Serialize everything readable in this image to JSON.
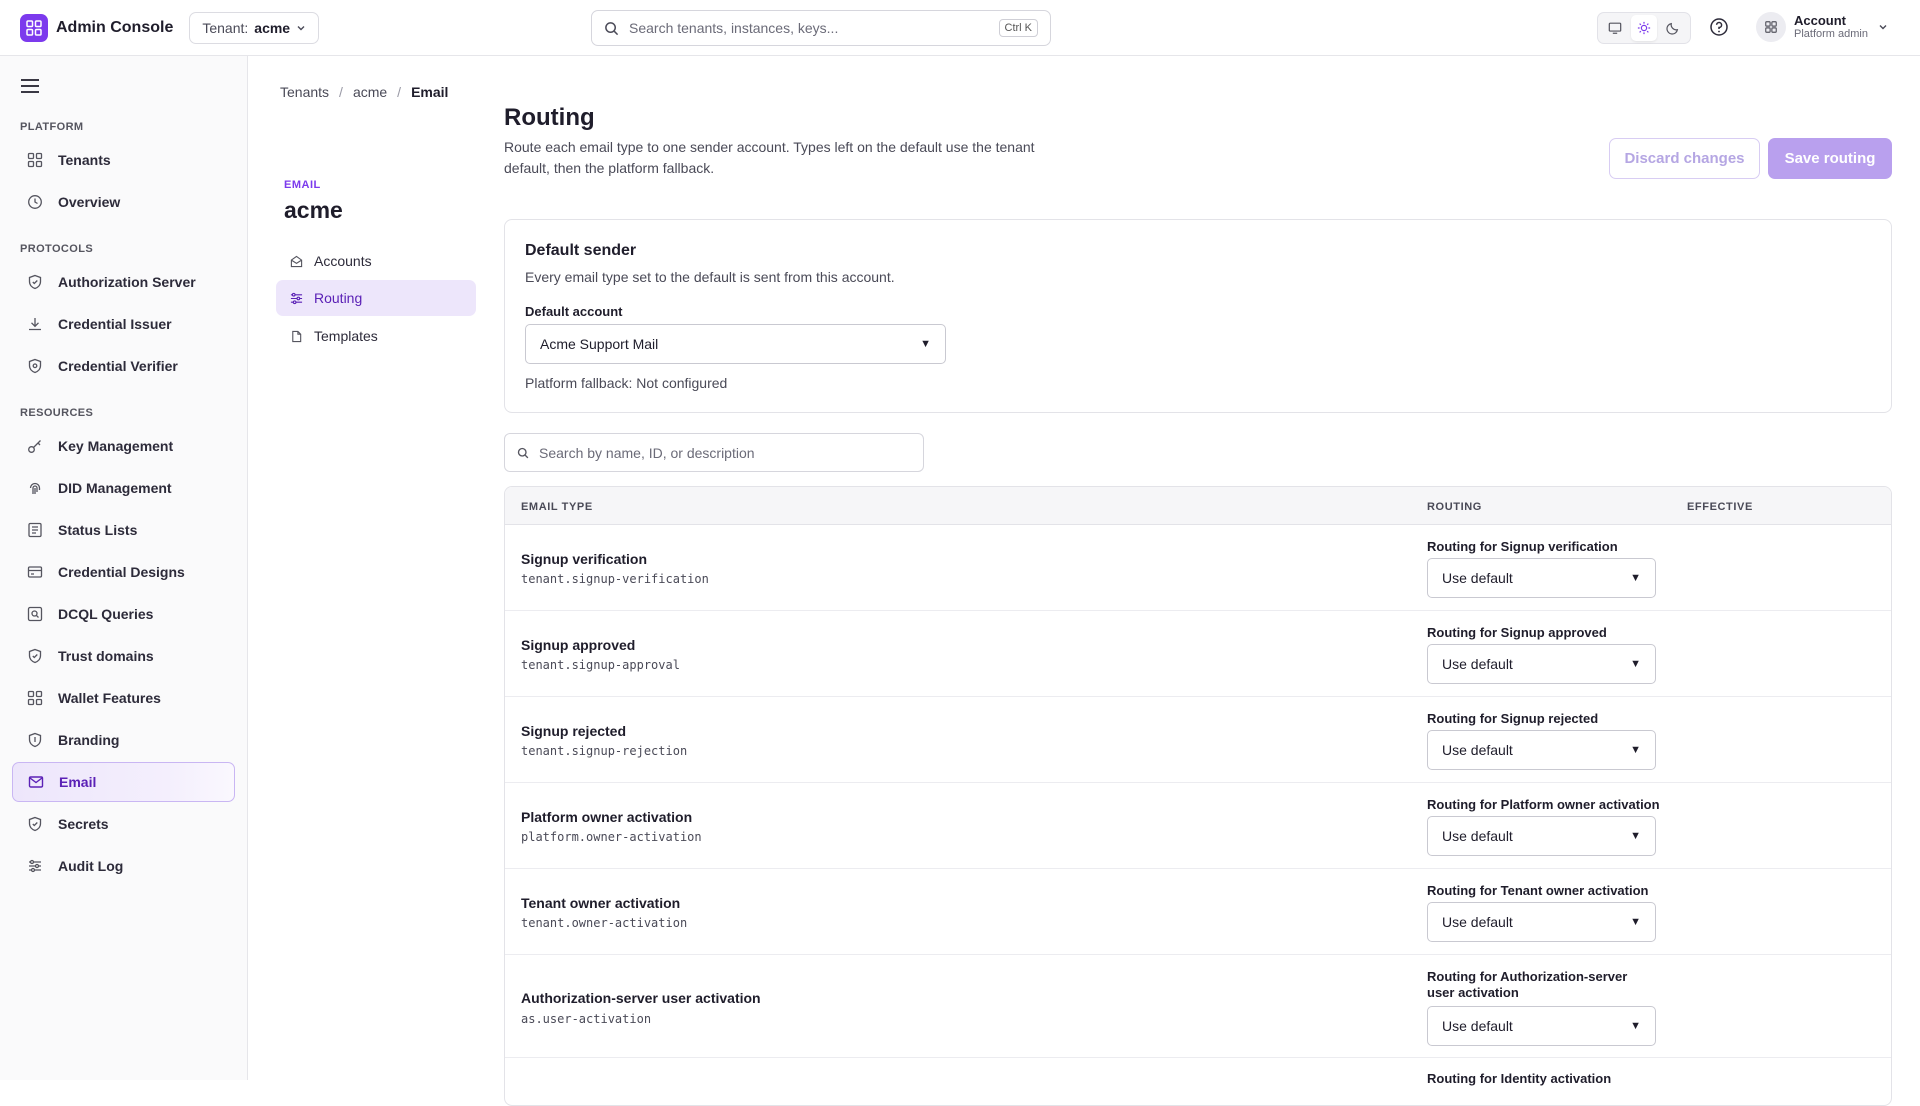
{
  "app": {
    "title": "Admin Console"
  },
  "tenant_selector": {
    "label": "Tenant:",
    "value": "acme"
  },
  "search": {
    "placeholder": "Search tenants, instances, keys...",
    "shortcut": "Ctrl K"
  },
  "account": {
    "name": "Account",
    "role": "Platform admin"
  },
  "theme": {
    "modes": [
      "system",
      "light",
      "dark"
    ],
    "active": "light"
  },
  "sidebar": {
    "sections": [
      {
        "title": "PLATFORM",
        "items": [
          {
            "label": "Tenants",
            "icon": "grid-icon"
          },
          {
            "label": "Overview",
            "icon": "clock-icon"
          }
        ]
      },
      {
        "title": "PROTOCOLS",
        "items": [
          {
            "label": "Authorization Server",
            "icon": "shield-icon"
          },
          {
            "label": "Credential Issuer",
            "icon": "download-icon"
          },
          {
            "label": "Credential Verifier",
            "icon": "shield-check-icon"
          }
        ]
      },
      {
        "title": "RESOURCES",
        "items": [
          {
            "label": "Key Management",
            "icon": "key-icon"
          },
          {
            "label": "DID Management",
            "icon": "fingerprint-icon"
          },
          {
            "label": "Status Lists",
            "icon": "list-icon"
          },
          {
            "label": "Credential Designs",
            "icon": "card-icon"
          },
          {
            "label": "DCQL Queries",
            "icon": "query-icon"
          },
          {
            "label": "Trust domains",
            "icon": "shield-icon"
          },
          {
            "label": "Wallet Features",
            "icon": "grid-icon"
          },
          {
            "label": "Branding",
            "icon": "badge-icon"
          },
          {
            "label": "Email",
            "icon": "mail-icon",
            "active": true
          },
          {
            "label": "Secrets",
            "icon": "shield-icon"
          },
          {
            "label": "Audit Log",
            "icon": "sliders-icon"
          }
        ]
      }
    ]
  },
  "breadcrumb": [
    "Tenants",
    "acme",
    "Email"
  ],
  "subnav": {
    "eyebrow": "EMAIL",
    "title": "acme",
    "items": [
      {
        "label": "Accounts",
        "icon": "mail-open-icon"
      },
      {
        "label": "Routing",
        "icon": "sliders-icon",
        "active": true
      },
      {
        "label": "Templates",
        "icon": "file-icon"
      }
    ]
  },
  "page": {
    "title": "Routing",
    "description": "Route each email type to one sender account. Types left on the default use the tenant default, then the platform fallback.",
    "discard_label": "Discard changes",
    "save_label": "Save routing"
  },
  "default_sender": {
    "title": "Default sender",
    "subtitle": "Every email type set to the default is sent from this account.",
    "field_label": "Default account",
    "value": "Acme Support Mail",
    "fallback": "Platform fallback: Not configured"
  },
  "filter": {
    "placeholder": "Search by name, ID, or description"
  },
  "table": {
    "headers": {
      "type": "EMAIL TYPE",
      "routing": "ROUTING",
      "effective": "EFFECTIVE"
    },
    "rows": [
      {
        "name": "Signup verification",
        "key": "tenant.signup-verification",
        "routing_label": "Routing for Signup verification",
        "value": "Use default"
      },
      {
        "name": "Signup approved",
        "key": "tenant.signup-approval",
        "routing_label": "Routing for Signup approved",
        "value": "Use default"
      },
      {
        "name": "Signup rejected",
        "key": "tenant.signup-rejection",
        "routing_label": "Routing for Signup rejected",
        "value": "Use default"
      },
      {
        "name": "Platform owner activation",
        "key": "platform.owner-activation",
        "routing_label": "Routing for Platform owner activation",
        "value": "Use default"
      },
      {
        "name": "Tenant owner activation",
        "key": "tenant.owner-activation",
        "routing_label": "Routing for Tenant owner activation",
        "value": "Use default"
      },
      {
        "name": "Authorization-server user activation",
        "key": "as.user-activation",
        "routing_label": "Routing for Authorization-server user activation",
        "value": "Use default"
      },
      {
        "name": "",
        "key": "",
        "routing_label": "Routing for Identity activation",
        "value": ""
      }
    ]
  },
  "colors": {
    "accent": "#7c3aed",
    "accent_soft": "#ede6fb"
  }
}
